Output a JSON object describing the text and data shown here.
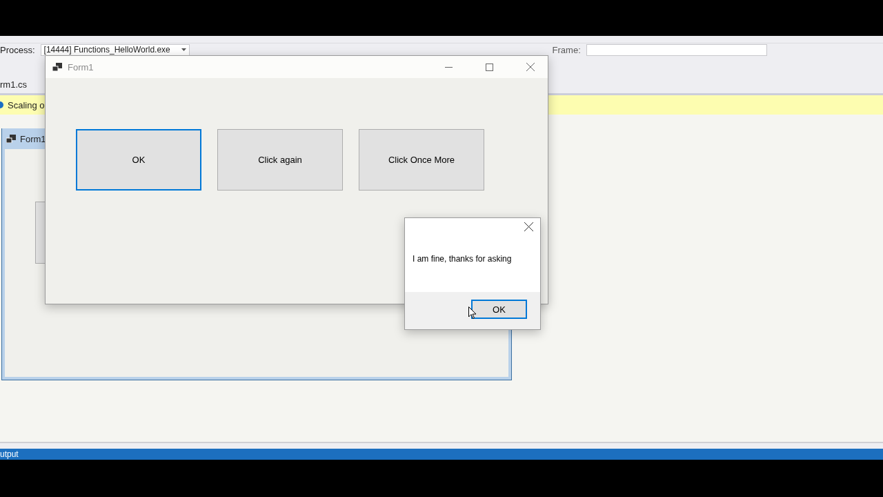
{
  "ide": {
    "debug_toolbar": {
      "process_label": "Process:",
      "process_value": "[14444] Functions_HelloWorld.exe",
      "stack_frame_label": "Frame:"
    },
    "document_tab": "rm1.cs",
    "info_bar": "Scaling o",
    "designer": {
      "form_title": "Form1"
    },
    "output_tab": "utput"
  },
  "form": {
    "title": "Form1",
    "buttons": [
      {
        "label": "OK",
        "focused": true
      },
      {
        "label": "Click again",
        "focused": false
      },
      {
        "label": "Click Once More",
        "focused": false
      }
    ]
  },
  "message_box": {
    "text": "I am fine, thanks for asking",
    "button": "OK",
    "button_focused": true
  }
}
